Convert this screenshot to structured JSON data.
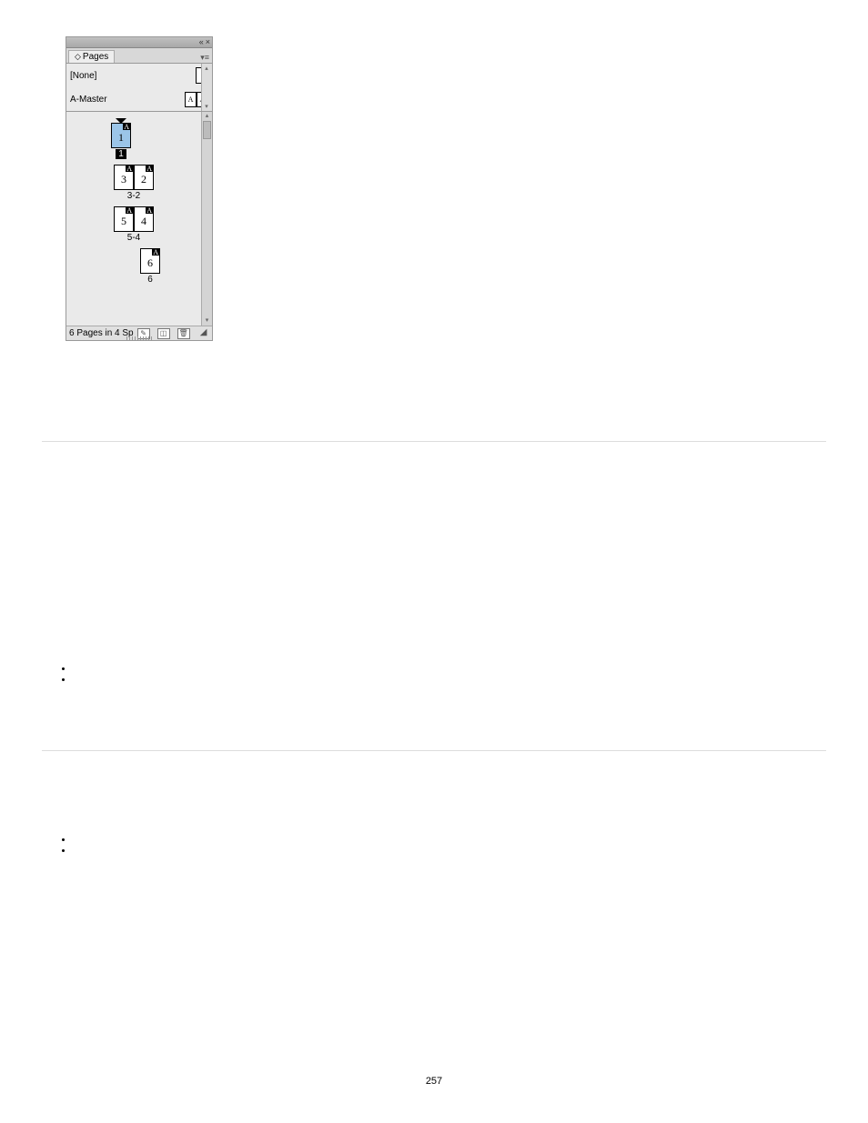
{
  "panel": {
    "tab_icon": "◇",
    "tab_label": "Pages",
    "collapse_icon": "«",
    "close_icon": "×",
    "menu_icon": "▾≡",
    "masters": [
      {
        "label": "[None]",
        "thumbs": [
          ""
        ]
      },
      {
        "label": "A-Master",
        "thumbs": [
          "A",
          "A"
        ]
      }
    ],
    "spreads": [
      {
        "pages": [
          {
            "master": "A",
            "num": "1",
            "selected": true
          }
        ],
        "label": "1",
        "label_style": "inv",
        "triangle": true
      },
      {
        "pages": [
          {
            "master": "A",
            "num": "3"
          },
          {
            "master": "A",
            "num": "2"
          }
        ],
        "label": "3-2"
      },
      {
        "pages": [
          {
            "master": "A",
            "num": "5"
          },
          {
            "master": "A",
            "num": "4"
          }
        ],
        "label": "5-4"
      },
      {
        "pages": [
          {
            "master": "A",
            "num": "6"
          }
        ],
        "label": "6",
        "align": "right"
      }
    ],
    "footer_text": "6 Pages in 4 Sp",
    "footer_icons": [
      "edit-page-size-icon",
      "new-page-icon",
      "delete-page-icon"
    ]
  },
  "page_number": "257"
}
